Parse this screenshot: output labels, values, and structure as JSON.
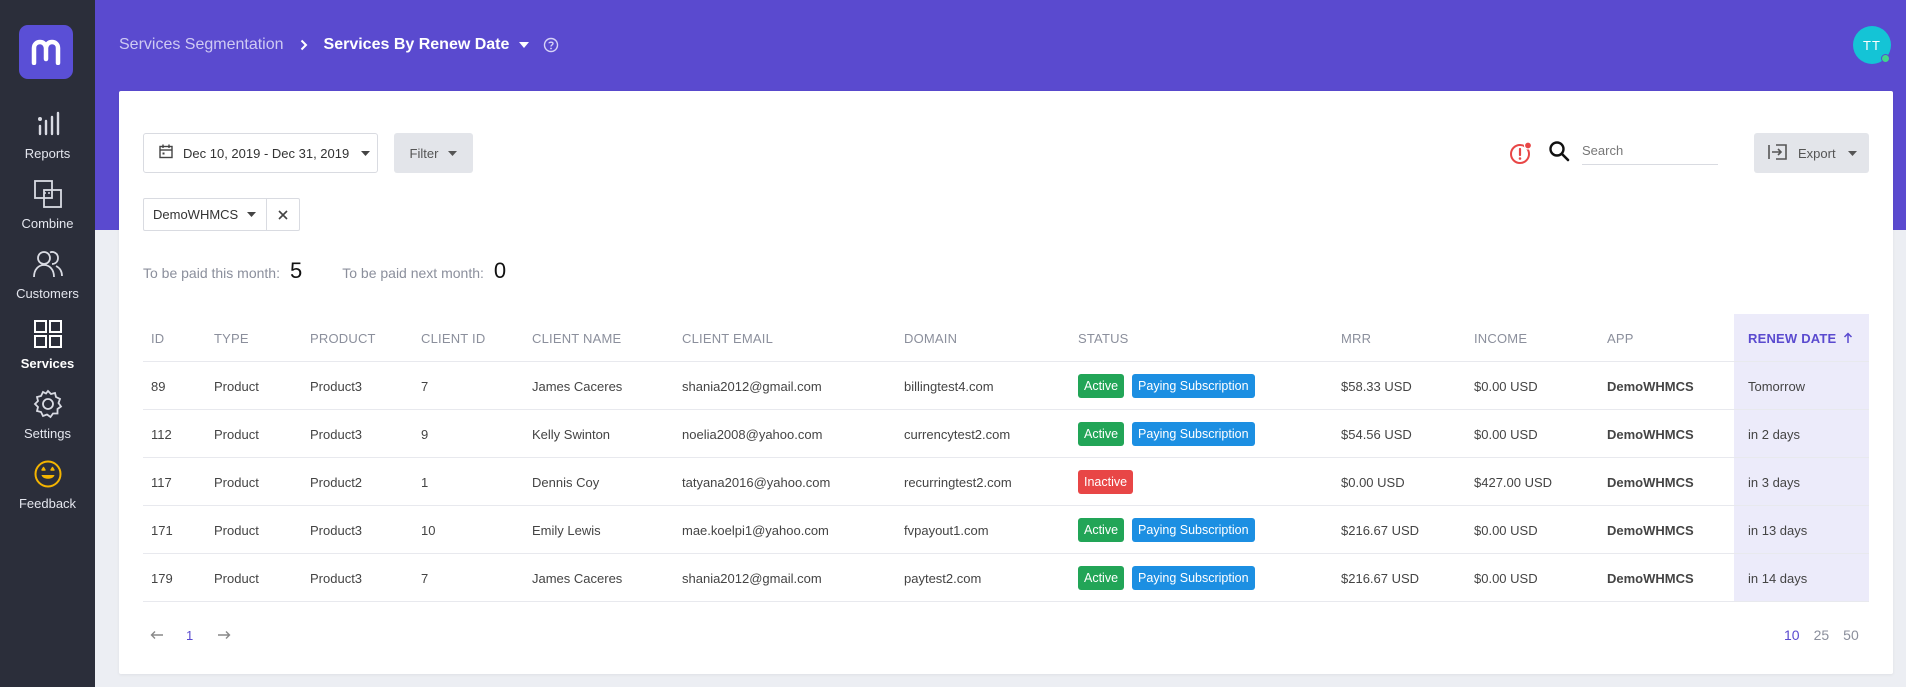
{
  "nav": {
    "items": [
      {
        "label": "Reports",
        "icon": "reports-icon"
      },
      {
        "label": "Combine",
        "icon": "combine-icon"
      },
      {
        "label": "Customers",
        "icon": "customers-icon"
      },
      {
        "label": "Services",
        "icon": "services-icon"
      },
      {
        "label": "Settings",
        "icon": "settings-icon"
      },
      {
        "label": "Feedback",
        "icon": "feedback-icon"
      }
    ],
    "active_index": 3
  },
  "header": {
    "breadcrumb_parent": "Services Segmentation",
    "breadcrumb_current": "Services By Renew Date",
    "avatar_initials": "TT"
  },
  "toolbar": {
    "date_range": "Dec 10, 2019 - Dec 31, 2019",
    "filter_label": "Filter",
    "search_placeholder": "Search",
    "export_label": "Export",
    "app_filter_value": "DemoWHMCS"
  },
  "summary": {
    "this_month_label": "To be paid this month:",
    "this_month_value": "5",
    "next_month_label": "To be paid next month:",
    "next_month_value": "0"
  },
  "table": {
    "columns": [
      "ID",
      "TYPE",
      "PRODUCT",
      "CLIENT ID",
      "CLIENT NAME",
      "CLIENT EMAIL",
      "DOMAIN",
      "STATUS",
      "MRR",
      "INCOME",
      "APP",
      "RENEW DATE"
    ],
    "sorted_column": "RENEW DATE",
    "rows": [
      {
        "id": "89",
        "type": "Product",
        "product": "Product3",
        "client_id": "7",
        "client_name": "James Caceres",
        "client_email": "shania2012@gmail.com",
        "domain": "billingtest4.com",
        "status": "Active",
        "status_extra": "Paying Subscription",
        "mrr": "$58.33 USD",
        "income": "$0.00 USD",
        "app": "DemoWHMCS",
        "renew_date": "Tomorrow"
      },
      {
        "id": "112",
        "type": "Product",
        "product": "Product3",
        "client_id": "9",
        "client_name": "Kelly Swinton",
        "client_email": "noelia2008@yahoo.com",
        "domain": "currencytest2.com",
        "status": "Active",
        "status_extra": "Paying Subscription",
        "mrr": "$54.56 USD",
        "income": "$0.00 USD",
        "app": "DemoWHMCS",
        "renew_date": "in 2 days"
      },
      {
        "id": "117",
        "type": "Product",
        "product": "Product2",
        "client_id": "1",
        "client_name": "Dennis Coy",
        "client_email": "tatyana2016@yahoo.com",
        "domain": "recurringtest2.com",
        "status": "Inactive",
        "status_extra": "",
        "mrr": "$0.00 USD",
        "income": "$427.00 USD",
        "app": "DemoWHMCS",
        "renew_date": "in 3 days"
      },
      {
        "id": "171",
        "type": "Product",
        "product": "Product3",
        "client_id": "10",
        "client_name": "Emily Lewis",
        "client_email": "mae.koelpi1@yahoo.com",
        "domain": "fvpayout1.com",
        "status": "Active",
        "status_extra": "Paying Subscription",
        "mrr": "$216.67 USD",
        "income": "$0.00 USD",
        "app": "DemoWHMCS",
        "renew_date": "in 13 days"
      },
      {
        "id": "179",
        "type": "Product",
        "product": "Product3",
        "client_id": "7",
        "client_name": "James Caceres",
        "client_email": "shania2012@gmail.com",
        "domain": "paytest2.com",
        "status": "Active",
        "status_extra": "Paying Subscription",
        "mrr": "$216.67 USD",
        "income": "$0.00 USD",
        "app": "DemoWHMCS",
        "renew_date": "in 14 days"
      }
    ]
  },
  "pagination": {
    "current_page": "1",
    "page_sizes": [
      "10",
      "25",
      "50"
    ],
    "selected_size": "10"
  },
  "colors": {
    "brand": "#5a4acf",
    "sidebar": "#2b2e3a",
    "active": "#22a557",
    "paying": "#1c8fe2",
    "inactive": "#e84646"
  }
}
